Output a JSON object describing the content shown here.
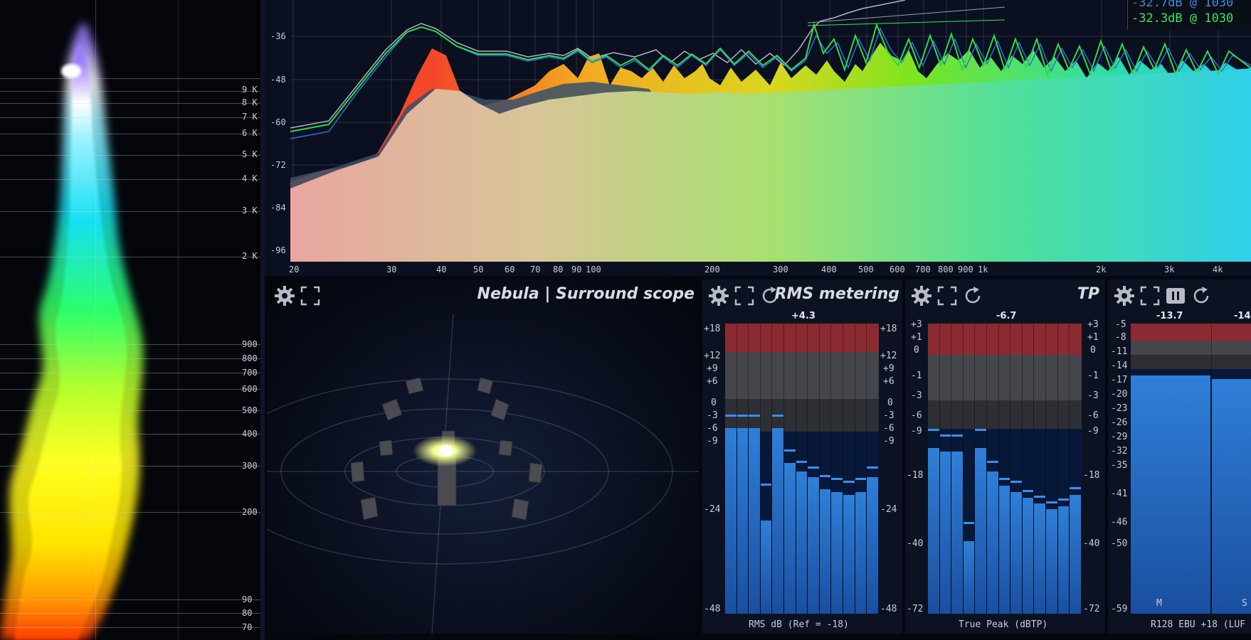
{
  "spectrogram": {
    "freq_labels": [
      "9 K",
      "8 K",
      "7 K",
      "6 K",
      "5 K",
      "4 K",
      "3 K",
      "2 K",
      "900",
      "800",
      "700",
      "600",
      "500",
      "400",
      "300",
      "200",
      "90",
      "80",
      "70"
    ]
  },
  "spectrum": {
    "db_labels": [
      "-36",
      "-48",
      "-60",
      "-72",
      "-84",
      "-96"
    ],
    "freq_labels": [
      "20",
      "30",
      "40",
      "50",
      "60",
      "70",
      "80",
      "90",
      "100",
      "200",
      "300",
      "400",
      "500",
      "600",
      "700",
      "800",
      "900",
      "1k",
      "2k",
      "3k",
      "4k"
    ],
    "readouts": [
      "-32.7dB @ 1030",
      "-32.3dB @ 1030"
    ]
  },
  "nebula": {
    "title": "Nebula | Surround scope"
  },
  "rms": {
    "title": "RMS metering",
    "peak_value": "+4.3",
    "scale": [
      "+18",
      "+12",
      "+9",
      "+6",
      "0",
      "-3",
      "-6",
      "-9",
      "-24",
      "-48"
    ],
    "footer": "RMS dB (Ref = -18)",
    "levels": [
      0.64,
      0.64,
      0.64,
      0.32,
      0.64,
      0.52,
      0.49,
      0.47,
      0.43,
      0.42,
      0.41,
      0.42,
      0.47
    ],
    "peaks": [
      0.68,
      0.68,
      0.68,
      0.44,
      0.68,
      0.56,
      0.52,
      0.5,
      0.47,
      0.46,
      0.45,
      0.46,
      0.5
    ]
  },
  "tp": {
    "title": "TP",
    "peak_value": "-6.7",
    "scale": [
      "+3",
      "+1",
      "0",
      "-1",
      "-3",
      "-6",
      "-9",
      "-18",
      "-40",
      "-72"
    ],
    "footer": "True Peak (dBTP)",
    "levels": [
      0.57,
      0.56,
      0.56,
      0.25,
      0.57,
      0.49,
      0.44,
      0.42,
      0.4,
      0.38,
      0.36,
      0.37,
      0.41
    ],
    "peaks": [
      0.63,
      0.61,
      0.61,
      0.31,
      0.63,
      0.52,
      0.46,
      0.45,
      0.42,
      0.4,
      0.38,
      0.39,
      0.43
    ]
  },
  "loudness": {
    "peak_values": [
      "-13.7",
      "-14"
    ],
    "scale": [
      "-5",
      "-8",
      "-11",
      "-14",
      "-17",
      "-20",
      "-23",
      "-26",
      "-29",
      "-32",
      "-35",
      "-41",
      "-46",
      "-50",
      "-59"
    ],
    "channel_labels": [
      "M",
      "S"
    ],
    "footer": "R128 EBU +18 (LUF",
    "levels": [
      0.82,
      0.81
    ]
  },
  "icons": [
    "gear-icon",
    "fullscreen-icon",
    "reset-icon",
    "pause-icon"
  ],
  "colors": {
    "panel_bg": "#0c1222",
    "accent_blue": "#1f6fc4",
    "red_zone": "#8b2a31",
    "readout_green": "#39e36a",
    "readout_blue": "#3d8ad8"
  }
}
